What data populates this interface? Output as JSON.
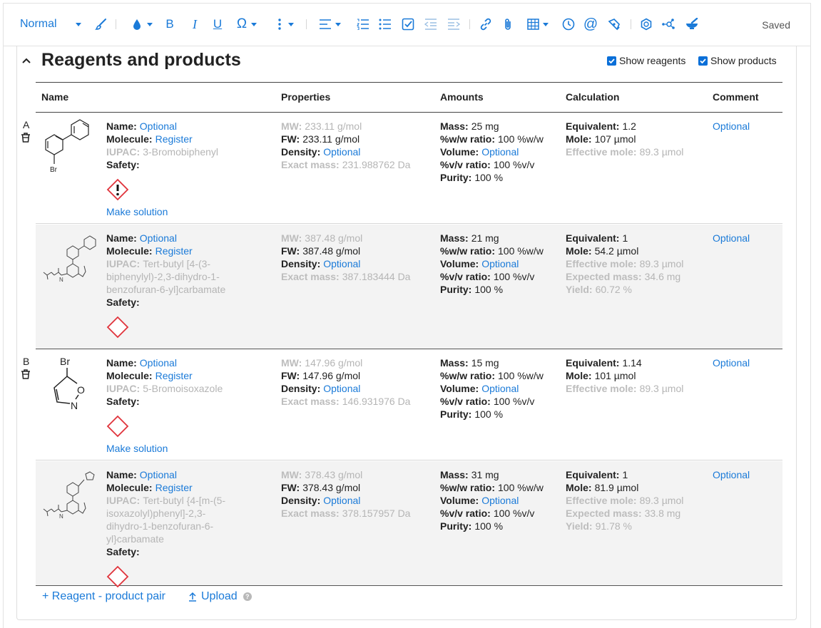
{
  "toolbar": {
    "style_value": "Normal",
    "saved": "Saved"
  },
  "section": {
    "title": "Reagents and products",
    "show_reagents": "Show reagents",
    "show_products": "Show products"
  },
  "columns": [
    "Name",
    "Properties",
    "Amounts",
    "Calculation",
    "Comment"
  ],
  "labels": {
    "name": "Name:",
    "molecule": "Molecule:",
    "iupac": "IUPAC:",
    "safety": "Safety:",
    "mw": "MW:",
    "fw": "FW:",
    "density": "Density:",
    "exact": "Exact mass:",
    "mass": "Mass:",
    "ww": "%w/w ratio:",
    "volume": "Volume:",
    "vv": "%v/v ratio:",
    "purity": "Purity:",
    "equiv": "Equivalent:",
    "mole": "Mole:",
    "eff": "Effective mole:",
    "expected": "Expected mass:",
    "yield": "Yield:"
  },
  "rows": [
    {
      "letter": "A",
      "name": "Optional",
      "molecule": "Register",
      "iupac": "3-Bromobiphenyl",
      "mw": "233.11 g/mol",
      "fw": "233.11 g/mol",
      "density": "Optional",
      "exact": "231.988762 Da",
      "mass": "25 mg",
      "ww": "100 %w/w",
      "volume": "Optional",
      "vv": "100 %v/v",
      "purity": "100 %",
      "equiv": "1.2",
      "mole": "107 µmol",
      "eff": "89.3 µmol",
      "comment": "Optional",
      "make_solution": "Make solution",
      "mol_label": "Br"
    },
    {
      "name": "Optional",
      "molecule": "Register",
      "iupac": "Tert-butyl [4-(3-biphenylyl)-2,3-dihydro-1-benzofuran-6-yl]carbamate",
      "mw": "387.48 g/mol",
      "fw": "387.48 g/mol",
      "density": "Optional",
      "exact": "387.183444 Da",
      "mass": "21 mg",
      "ww": "100 %w/w",
      "volume": "Optional",
      "vv": "100 %v/v",
      "purity": "100 %",
      "equiv": "1",
      "mole": "54.2 µmol",
      "eff": "89.3 µmol",
      "expected": "34.6 mg",
      "yield": "60.72 %",
      "comment": "Optional",
      "mol_label": "N"
    },
    {
      "letter": "B",
      "name": "Optional",
      "molecule": "Register",
      "iupac": "5-Bromoisoxazole",
      "mw": "147.96 g/mol",
      "fw": "147.96 g/mol",
      "density": "Optional",
      "exact": "146.931976 Da",
      "mass": "15 mg",
      "ww": "100 %w/w",
      "volume": "Optional",
      "vv": "100 %v/v",
      "purity": "100 %",
      "equiv": "1.14",
      "mole": "101 µmol",
      "eff": "89.3 µmol",
      "comment": "Optional",
      "make_solution": "Make solution",
      "mol_label_br": "Br",
      "mol_label_o": "O",
      "mol_label_n": "N"
    },
    {
      "name": "Optional",
      "molecule": "Register",
      "iupac": "Tert-butyl {4-[m-(5-isoxazolyl)phenyl]-2,3-dihydro-1-benzofuran-6-yl}carbamate",
      "mw": "378.43 g/mol",
      "fw": "378.43 g/mol",
      "density": "Optional",
      "exact": "378.157957 Da",
      "mass": "31 mg",
      "ww": "100 %w/w",
      "volume": "Optional",
      "vv": "100 %v/v",
      "purity": "100 %",
      "equiv": "1",
      "mole": "81.9 µmol",
      "eff": "89.3 µmol",
      "expected": "33.8 mg",
      "yield": "91.78 %",
      "comment": "Optional",
      "mol_label": "N"
    }
  ],
  "footer": {
    "add_pair": "+ Reagent - product pair",
    "upload": "Upload",
    "help": "?"
  }
}
